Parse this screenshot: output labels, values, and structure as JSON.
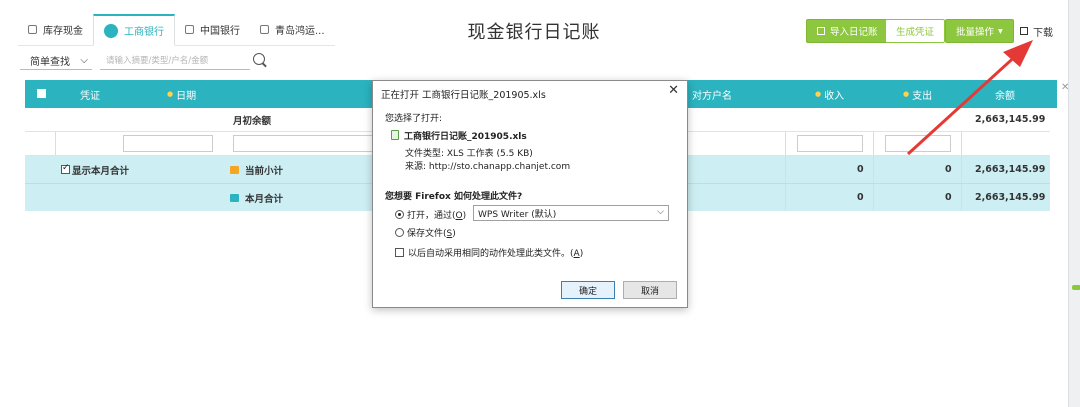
{
  "tabs": [
    {
      "label": "库存现金",
      "active": false
    },
    {
      "label": "工商银行",
      "active": true
    },
    {
      "label": "中国银行",
      "active": false
    },
    {
      "label": "青岛鸿运...",
      "active": false
    }
  ],
  "page_title": "现金银行日记账",
  "toolbar": {
    "import_label": "导入日记账",
    "voucher_label": "生成凭证",
    "batch_label": "批量操作",
    "download_label": "下载"
  },
  "search": {
    "mode": "简单查找",
    "placeholder": "请输入摘要/类型/户名/金额"
  },
  "table": {
    "headers": {
      "voucher": "凭证",
      "date": "日期",
      "counterparty": "对方户名",
      "income": "收入",
      "expense": "支出",
      "balance": "余额"
    },
    "opening": {
      "label": "月初余额",
      "balance": "2,663,145.99"
    },
    "subtotal": {
      "show_month_label": "显示本月合计",
      "label": "当前小计",
      "income": "0",
      "expense": "0",
      "balance": "2,663,145.99"
    },
    "monthtotal": {
      "label": "本月合计",
      "income": "0",
      "expense": "0",
      "balance": "2,663,145.99"
    }
  },
  "dialog": {
    "title": "正在打开 工商银行日记账_201905.xls",
    "chosen_label": "您选择了打开:",
    "filename": "工商银行日记账_201905.xls",
    "file_type": "文件类型:   XLS 工作表 (5.5 KB)",
    "source": "来源:   http://sto.chanapp.chanjet.com",
    "question": "您想要 Firefox 如何处理此文件?",
    "open_with_label": "打开，通过(",
    "open_with_key": "O",
    "open_with_close": ")",
    "app_selected": "WPS Writer (默认)",
    "save_label": "保存文件(",
    "save_key": "S",
    "save_close": ")",
    "auto_label": "以后自动采用相同的动作处理此类文件。(",
    "auto_key": "A",
    "auto_close": ")",
    "ok": "确定",
    "cancel": "取消"
  },
  "colors": {
    "teal": "#2bb3c0",
    "green": "#8dc63f",
    "arrow": "#e53935"
  }
}
